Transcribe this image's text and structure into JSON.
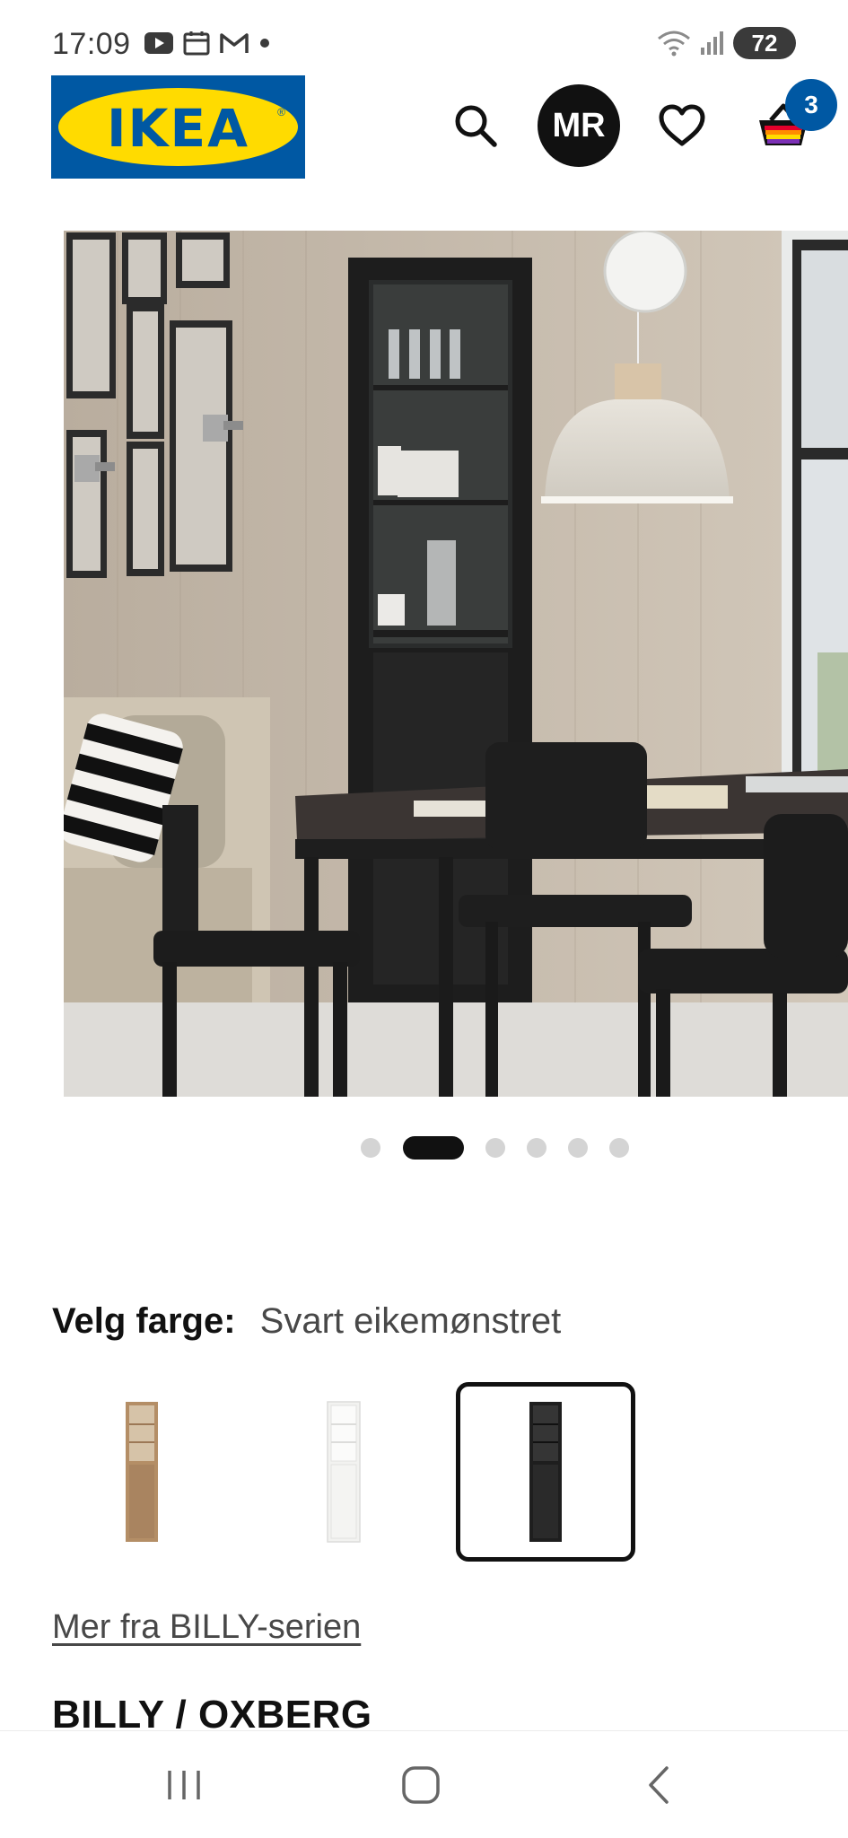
{
  "status_bar": {
    "time": "17:09",
    "battery": "72",
    "icons": [
      "youtube-icon",
      "calendar-icon",
      "gmail-icon",
      "dot-icon",
      "wifi-icon",
      "signal-icon",
      "battery-icon"
    ]
  },
  "header": {
    "logo_text": "IKEA",
    "logo_registered": "®",
    "avatar_initials": "MR",
    "cart_count": "3",
    "colors": {
      "brand_blue": "#0058a3",
      "brand_yellow": "#ffdb00"
    }
  },
  "carousel": {
    "total_images": 6,
    "active_index": 1
  },
  "color_picker": {
    "label": "Velg farge:",
    "selected_value": "Svart eikemønstret",
    "options": [
      {
        "name": "oak",
        "color": "#b48e66",
        "selected": false
      },
      {
        "name": "white",
        "color": "#f2f2f0",
        "selected": false
      },
      {
        "name": "black",
        "color": "#2a2a2a",
        "selected": true
      }
    ]
  },
  "series_link": "Mer fra BILLY-serien",
  "product_title": "BILLY / OXBERG"
}
